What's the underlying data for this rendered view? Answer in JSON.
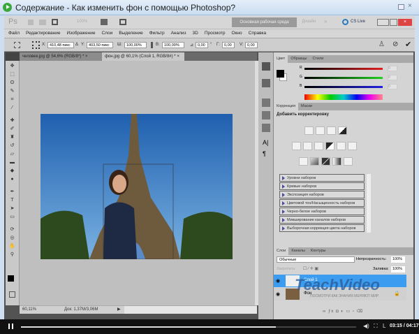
{
  "window": {
    "title": "Содержание - Как изменить фон с помощью Photoshop?"
  },
  "app": {
    "logo": "Ps",
    "zoom": "100%",
    "workspace": "Основная рабочая среда",
    "design": "Дизайн",
    "more": "»",
    "cslive": "CS Live"
  },
  "menu": [
    "Файл",
    "Редактирование",
    "Изображение",
    "Слои",
    "Выделение",
    "Фильтр",
    "Анализ",
    "3D",
    "Просмотр",
    "Окно",
    "Справка"
  ],
  "options": {
    "x_label": "X:",
    "x": "410,48 пикс",
    "y_label": "Y:",
    "y": "403,50 пикс",
    "w_label": "Ш:",
    "w": "100,00%",
    "h_label": "В:",
    "h": "100,00%",
    "angle": "0,00",
    "angle_unit": "°",
    "hskew_label": "Г:",
    "hskew": "0,00",
    "vskew_label": "V:",
    "vskew": "0,00"
  },
  "doc_tabs": [
    {
      "label": "человек.jpg @ 54,6% (RGB/8*) *",
      "close": "×"
    },
    {
      "label": "фон.jpg @ 60,1% (Слой 1, RGB/8#) *",
      "close": "×"
    }
  ],
  "status": {
    "zoom": "60,11%",
    "doc": "Док: 1,37M/3,06M"
  },
  "color_panel": {
    "tabs": [
      "Цвет",
      "Образцы",
      "Стили"
    ],
    "channels": [
      {
        "name": "R",
        "value": "0",
        "color": "#e02020"
      },
      {
        "name": "G",
        "value": "0",
        "color": "#20d020"
      },
      {
        "name": "B",
        "value": "0",
        "color": "#2020e0"
      }
    ]
  },
  "corrections": {
    "tabs": [
      "Коррекция",
      "Маски"
    ],
    "heading": "Добавить корректировку",
    "presets": [
      "Уровни наборов",
      "Кривые наборов",
      "Экспозиция наборов",
      "Цветовой тон/Насыщенность наборов",
      "Черно-белое наборов",
      "Микширование каналов наборов",
      "Выборочная коррекция цвета наборов"
    ]
  },
  "layers": {
    "tabs": [
      "Слои",
      "Каналы",
      "Контуры"
    ],
    "blend": "Обычные",
    "opacity_label": "Непрозрачность:",
    "opacity": "100%",
    "lock_label": "Закрепить:",
    "fill_label": "Заливка:",
    "fill": "100%",
    "items": [
      {
        "name": "Слой 1",
        "selected": true
      },
      {
        "name": "Фон",
        "selected": false
      }
    ]
  },
  "watermark": {
    "brand": "TeachVideo",
    "tagline": "ПОСМОТРИ КАК ЗНАНИЯ МЕНЯЮТ МИР"
  },
  "player": {
    "time": "03:15 / 04:17",
    "progress": 0.76
  }
}
